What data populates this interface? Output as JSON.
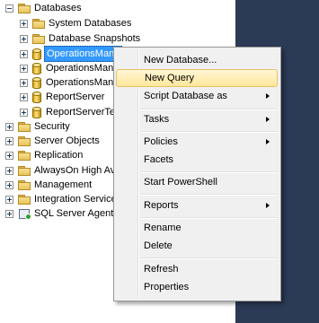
{
  "tree": {
    "databases": "Databases",
    "system_databases": "System Databases",
    "database_snapshots": "Database Snapshots",
    "db_items": [
      "OperationsMana",
      "OperationsMana",
      "OperationsMana",
      "ReportServer",
      "ReportServerTer"
    ],
    "security": "Security",
    "server_objects": "Server Objects",
    "replication": "Replication",
    "alwayson": "AlwaysOn High Ava",
    "management": "Management",
    "integration_services": "Integration Services",
    "sql_server_agent": "SQL Server Agent"
  },
  "context_menu": {
    "new_database": "New Database...",
    "new_query": "New Query",
    "script_database_as": "Script Database as",
    "tasks": "Tasks",
    "policies": "Policies",
    "facets": "Facets",
    "start_powershell": "Start PowerShell",
    "reports": "Reports",
    "rename": "Rename",
    "delete": "Delete",
    "refresh": "Refresh",
    "properties": "Properties",
    "hovered_item": "New Query"
  },
  "colors": {
    "selection": "#3399ff",
    "menu_hover": "#ffe79a",
    "right_panel": "#2b3a55"
  }
}
